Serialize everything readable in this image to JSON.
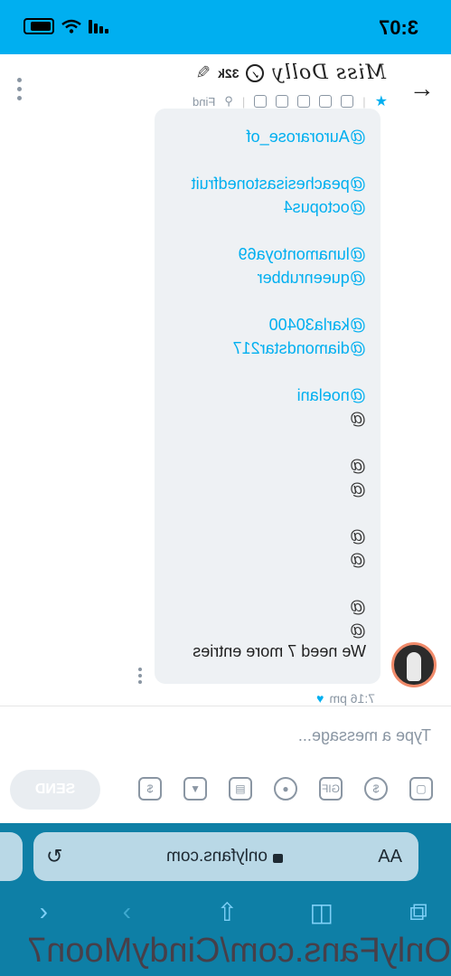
{
  "status_bar": {
    "time": "3:07"
  },
  "header": {
    "name": "Miss Dolly",
    "subscribers": "32k",
    "find_label": "Find"
  },
  "messages": {
    "lines": [
      {
        "text": "@Aurorarose_of",
        "type": "mention"
      },
      {
        "text": "",
        "type": "gap"
      },
      {
        "text": "@peachesisastonedfruit",
        "type": "mention"
      },
      {
        "text": "@octopus4",
        "type": "mention"
      },
      {
        "text": "",
        "type": "gap"
      },
      {
        "text": "@lunamontoya69",
        "type": "mention"
      },
      {
        "text": "@queenrubber",
        "type": "mention"
      },
      {
        "text": "",
        "type": "gap"
      },
      {
        "text": "@karla30400",
        "type": "mention"
      },
      {
        "text": "@diamondstar217",
        "type": "mention"
      },
      {
        "text": "",
        "type": "gap"
      },
      {
        "text": "@noelani",
        "type": "mention"
      },
      {
        "text": "@",
        "type": "plain"
      },
      {
        "text": "",
        "type": "gap"
      },
      {
        "text": "@",
        "type": "plain"
      },
      {
        "text": "@",
        "type": "plain"
      },
      {
        "text": "",
        "type": "gap"
      },
      {
        "text": "@",
        "type": "plain"
      },
      {
        "text": "@",
        "type": "plain"
      },
      {
        "text": "",
        "type": "gap"
      },
      {
        "text": "@",
        "type": "plain"
      },
      {
        "text": "@",
        "type": "plain"
      }
    ],
    "last_message": "We need 7 more entries",
    "time": "7:16 pm"
  },
  "composer": {
    "placeholder": "Type a message...",
    "send_label": "SEND",
    "gif_label": "GIF"
  },
  "browser": {
    "aa_label": "AA",
    "url": "onlyfans.com"
  },
  "watermark": "OnlyFans.com/CindyMoon7",
  "colors": {
    "accent": "#00aff0",
    "browser_bar": "#0e7fa6"
  }
}
